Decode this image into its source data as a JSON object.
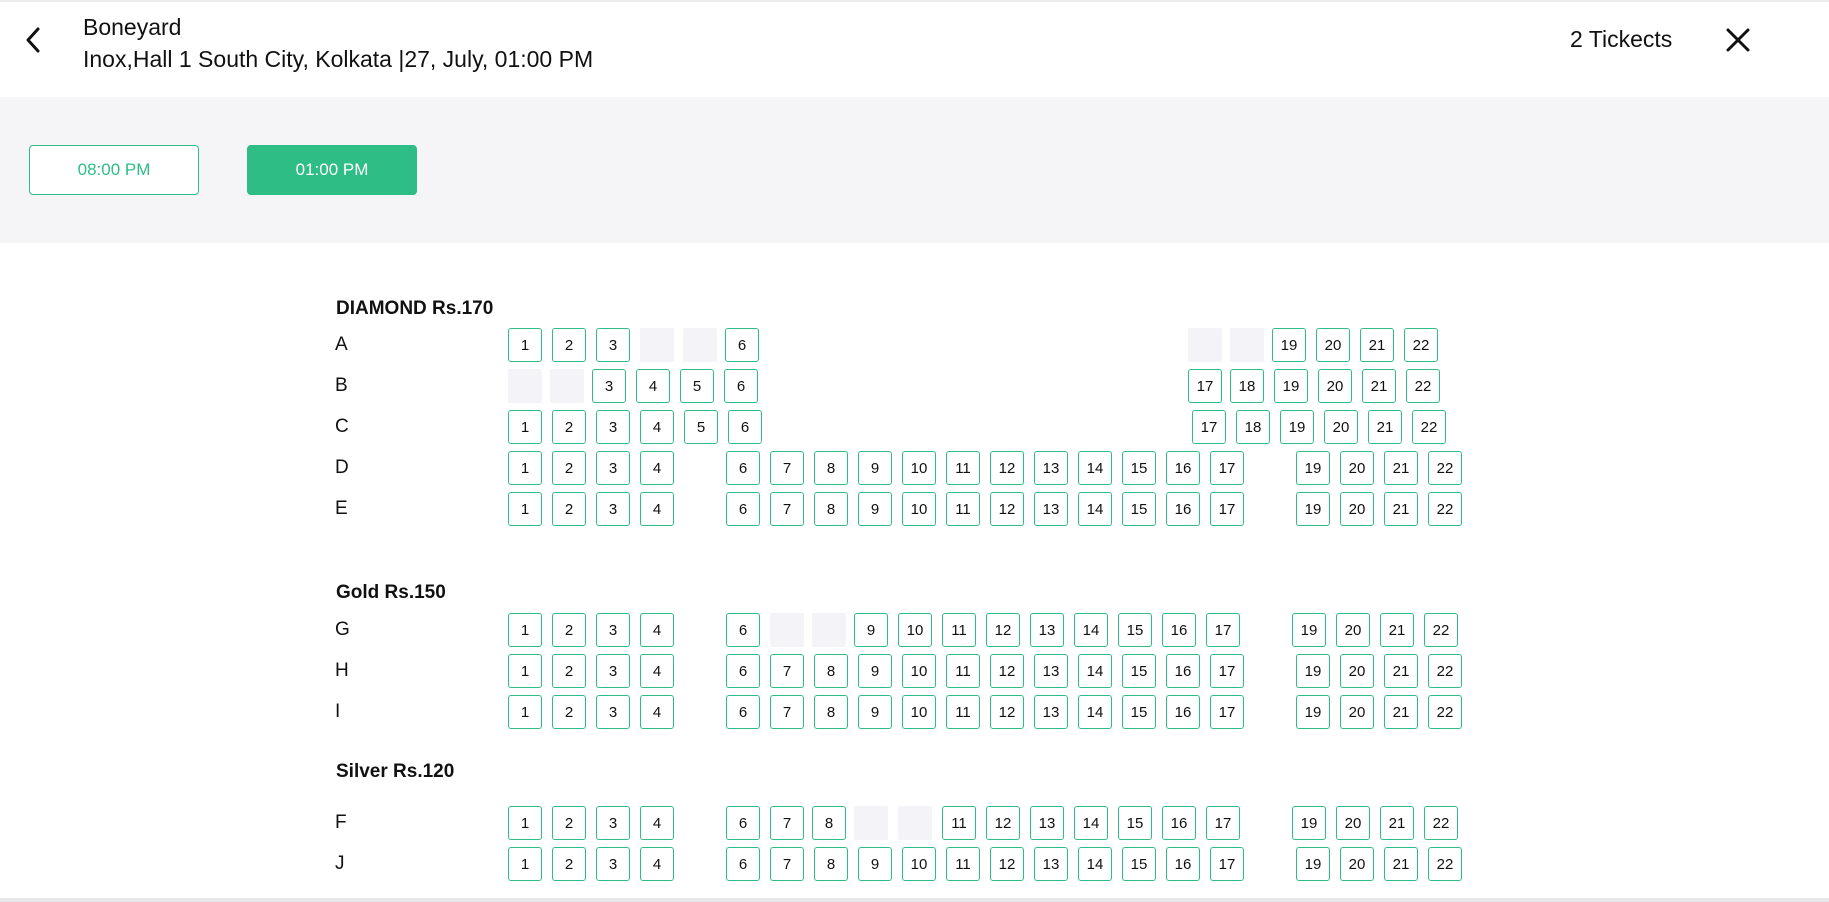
{
  "header": {
    "title": "Boneyard",
    "subtitle": "Inox,Hall 1 South City, Kolkata |27, July, 01:00 PM",
    "tickets": "2 Tickects"
  },
  "showtimes": [
    "08:00 PM",
    "01:00 PM"
  ],
  "selected_showtime": "01:00 PM",
  "colors": {
    "accent": "#2ebd85",
    "panel": "#f5f5f8",
    "unavailable": "#f4f4f8"
  },
  "icons": {
    "back": "chevron-left-icon",
    "close": "close-icon"
  },
  "sections": [
    {
      "title": "DIAMOND Rs.170",
      "rows": [
        {
          "label": "A",
          "seats": [
            {
              "n": "1"
            },
            {
              "n": "2"
            },
            {
              "n": "3"
            },
            {
              "n": "",
              "gap": true
            },
            {
              "n": "",
              "gap": true
            },
            {
              "n": "6"
            },
            {
              "n": "",
              "gap": true
            },
            {
              "n": "",
              "gap": true
            },
            {
              "n": "19"
            },
            {
              "n": "20"
            },
            {
              "n": "21"
            },
            {
              "n": "22"
            }
          ]
        },
        {
          "label": "B",
          "seats": [
            {
              "n": "",
              "gap": true
            },
            {
              "n": "",
              "gap": true
            },
            {
              "n": "3"
            },
            {
              "n": "4"
            },
            {
              "n": "5"
            },
            {
              "n": "6"
            },
            {
              "n": "17"
            },
            {
              "n": "18"
            },
            {
              "n": "19"
            },
            {
              "n": "20"
            },
            {
              "n": "21"
            },
            {
              "n": "22"
            }
          ]
        },
        {
          "label": "C",
          "seats": [
            {
              "n": "1"
            },
            {
              "n": "2"
            },
            {
              "n": "3"
            },
            {
              "n": "4"
            },
            {
              "n": "5"
            },
            {
              "n": "6"
            },
            {
              "n": "17"
            },
            {
              "n": "18"
            },
            {
              "n": "19"
            },
            {
              "n": "20"
            },
            {
              "n": "21"
            },
            {
              "n": "22"
            }
          ]
        },
        {
          "label": "D",
          "seats": [
            {
              "n": "1"
            },
            {
              "n": "2"
            },
            {
              "n": "3"
            },
            {
              "n": "4"
            },
            {
              "n": "6"
            },
            {
              "n": "7"
            },
            {
              "n": "8"
            },
            {
              "n": "9"
            },
            {
              "n": "10"
            },
            {
              "n": "11"
            },
            {
              "n": "12"
            },
            {
              "n": "13"
            },
            {
              "n": "14"
            },
            {
              "n": "15"
            },
            {
              "n": "16"
            },
            {
              "n": "17"
            },
            {
              "n": "19"
            },
            {
              "n": "20"
            },
            {
              "n": "21"
            },
            {
              "n": "22"
            }
          ]
        },
        {
          "label": "E",
          "seats": [
            {
              "n": "1"
            },
            {
              "n": "2"
            },
            {
              "n": "3"
            },
            {
              "n": "4"
            },
            {
              "n": "6"
            },
            {
              "n": "7"
            },
            {
              "n": "8"
            },
            {
              "n": "9"
            },
            {
              "n": "10"
            },
            {
              "n": "11"
            },
            {
              "n": "12"
            },
            {
              "n": "13"
            },
            {
              "n": "14"
            },
            {
              "n": "15"
            },
            {
              "n": "16"
            },
            {
              "n": "17"
            },
            {
              "n": "19"
            },
            {
              "n": "20"
            },
            {
              "n": "21"
            },
            {
              "n": "22"
            }
          ]
        }
      ]
    },
    {
      "title": "Gold Rs.150",
      "rows": [
        {
          "label": "G",
          "seats": [
            {
              "n": "1"
            },
            {
              "n": "2"
            },
            {
              "n": "3"
            },
            {
              "n": "4"
            },
            {
              "n": "6"
            },
            {
              "n": "",
              "gap": true
            },
            {
              "n": "",
              "gap": true
            },
            {
              "n": "9"
            },
            {
              "n": "10"
            },
            {
              "n": "11"
            },
            {
              "n": "12"
            },
            {
              "n": "13"
            },
            {
              "n": "14"
            },
            {
              "n": "15"
            },
            {
              "n": "16"
            },
            {
              "n": "17"
            },
            {
              "n": "19"
            },
            {
              "n": "20"
            },
            {
              "n": "21"
            },
            {
              "n": "22"
            }
          ]
        },
        {
          "label": "H",
          "seats": [
            {
              "n": "1"
            },
            {
              "n": "2"
            },
            {
              "n": "3"
            },
            {
              "n": "4"
            },
            {
              "n": "6"
            },
            {
              "n": "7"
            },
            {
              "n": "8"
            },
            {
              "n": "9"
            },
            {
              "n": "10"
            },
            {
              "n": "11"
            },
            {
              "n": "12"
            },
            {
              "n": "13"
            },
            {
              "n": "14"
            },
            {
              "n": "15"
            },
            {
              "n": "16"
            },
            {
              "n": "17"
            },
            {
              "n": "19"
            },
            {
              "n": "20"
            },
            {
              "n": "21"
            },
            {
              "n": "22"
            }
          ]
        },
        {
          "label": "I",
          "seats": [
            {
              "n": "1"
            },
            {
              "n": "2"
            },
            {
              "n": "3"
            },
            {
              "n": "4"
            },
            {
              "n": "6"
            },
            {
              "n": "7"
            },
            {
              "n": "8"
            },
            {
              "n": "9"
            },
            {
              "n": "10"
            },
            {
              "n": "11"
            },
            {
              "n": "12"
            },
            {
              "n": "13"
            },
            {
              "n": "14"
            },
            {
              "n": "15"
            },
            {
              "n": "16"
            },
            {
              "n": "17"
            },
            {
              "n": "19"
            },
            {
              "n": "20"
            },
            {
              "n": "21"
            },
            {
              "n": "22"
            }
          ]
        }
      ]
    },
    {
      "title": "Silver Rs.120",
      "rows": [
        {
          "label": "F",
          "seats": [
            {
              "n": "1"
            },
            {
              "n": "2"
            },
            {
              "n": "3"
            },
            {
              "n": "4"
            },
            {
              "n": "6"
            },
            {
              "n": "7"
            },
            {
              "n": "8"
            },
            {
              "n": "",
              "gap": true
            },
            {
              "n": "",
              "gap": true
            },
            {
              "n": "11"
            },
            {
              "n": "12"
            },
            {
              "n": "13"
            },
            {
              "n": "14"
            },
            {
              "n": "15"
            },
            {
              "n": "16"
            },
            {
              "n": "17"
            },
            {
              "n": "19"
            },
            {
              "n": "20"
            },
            {
              "n": "21"
            },
            {
              "n": "22"
            }
          ]
        },
        {
          "label": "J",
          "seats": [
            {
              "n": "1"
            },
            {
              "n": "2"
            },
            {
              "n": "3"
            },
            {
              "n": "4"
            },
            {
              "n": "6"
            },
            {
              "n": "7"
            },
            {
              "n": "8"
            },
            {
              "n": "9"
            },
            {
              "n": "10"
            },
            {
              "n": "11"
            },
            {
              "n": "12"
            },
            {
              "n": "13"
            },
            {
              "n": "14"
            },
            {
              "n": "15"
            },
            {
              "n": "16"
            },
            {
              "n": "17"
            },
            {
              "n": "19"
            },
            {
              "n": "20"
            },
            {
              "n": "21"
            },
            {
              "n": "22"
            }
          ]
        }
      ]
    }
  ]
}
